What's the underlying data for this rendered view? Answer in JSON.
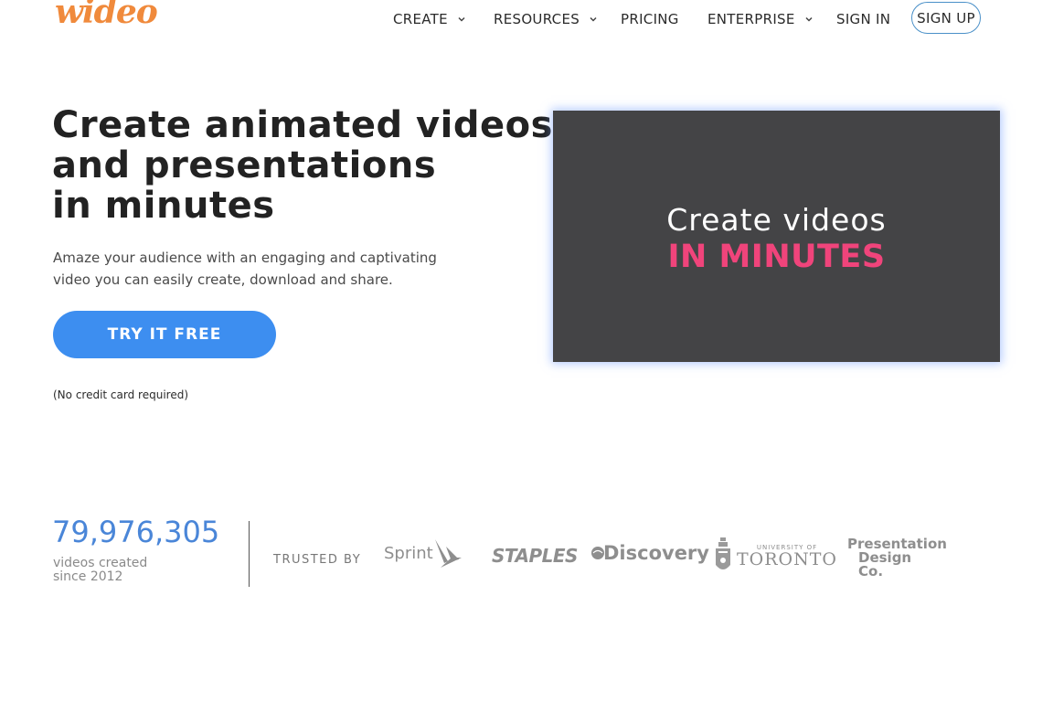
{
  "header": {
    "logo_text": "wideo",
    "nav": [
      {
        "label": "CREATE",
        "has_dropdown": true
      },
      {
        "label": "RESOURCES",
        "has_dropdown": true
      },
      {
        "label": "PRICING",
        "has_dropdown": false
      },
      {
        "label": "ENTERPRISE",
        "has_dropdown": true
      },
      {
        "label": "SIGN IN",
        "has_dropdown": false
      }
    ],
    "signup_label": "SIGN UP"
  },
  "hero": {
    "title_lines": [
      "Create animated videos",
      "and presentations",
      "in minutes"
    ],
    "subtitle_lines": [
      "Amaze your audience with an engaging and captivating",
      "video you can easily create, download and share."
    ],
    "cta_label": "TRY IT FREE",
    "cta_note": "(No credit card required)"
  },
  "video": {
    "line1": "Create videos",
    "line2": "IN MINUTES"
  },
  "stats": {
    "count": "79,976,305",
    "label_lines": [
      "videos created",
      "since 2012"
    ]
  },
  "trusted": {
    "label": "TRUSTED BY",
    "brands": {
      "sprint": "Sprint",
      "staples": "STAPLES",
      "discovery": "Discovery",
      "toronto_small": "UNIVERSITY OF",
      "toronto_big": "TORONTO",
      "pdc_lines": [
        "Presentation",
        "Design",
        "Co."
      ]
    }
  },
  "colors": {
    "logo": "#f08a3c",
    "cta": "#3d8ef0",
    "stat_number": "#4a86d8",
    "video_bg": "#444446",
    "video_accent": "#f0447b"
  },
  "icons": [
    "chevron-down-icon",
    "sprint-wing-icon",
    "discovery-globe-icon",
    "toronto-crest-icon"
  ]
}
